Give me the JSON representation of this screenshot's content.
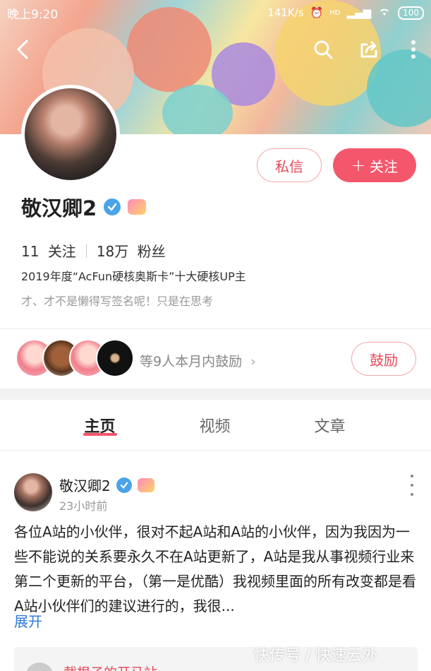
{
  "status_bar": {
    "time": "晚上9:20",
    "speed": "141K/s",
    "battery": "100",
    "network": "HD"
  },
  "profile": {
    "name": "敬汉卿2",
    "follow_count": "11",
    "follow_label": "关注",
    "fans_count": "18万",
    "fans_label": "粉丝",
    "award": "2019年度“AcFun硬核奥斯卡”十大硬核UP主",
    "signature": "才、才不是懒得写签名呢！只是在思考"
  },
  "actions": {
    "message": "私信",
    "follow": "关注",
    "follow_plus": "+",
    "cheer": "鼓励"
  },
  "cheer_row": {
    "text": "等9人本月内鼓励",
    "chevron": "›"
  },
  "tabs": [
    {
      "label": "主页"
    },
    {
      "label": "视频"
    },
    {
      "label": "文章"
    }
  ],
  "post": {
    "author": "敬汉卿2",
    "time": "23小时前",
    "text": "各位A站的小伙伴，很对不起A站和A站的小伙伴，因为我因为一些不能说的关系要永久不在A站更新了，A站是我从事视频行业来第二个更新的平台，（第一是优酷）我视频里面的所有改变都是看A站小伙伴们的建议进行的，我很...",
    "expand": "展开"
  },
  "shared": {
    "name": "截根子的开马站"
  },
  "watermark": "快传号 / 快速云外",
  "icons": {
    "back": "back-icon",
    "search": "search-icon",
    "share": "share-icon",
    "more": "more-icon",
    "verified": "verified-icon",
    "up_badge": "up-badge-icon"
  },
  "colors": {
    "accent": "#f4576b",
    "accent_text": "#e4495a",
    "link": "#2f7ad8",
    "verified": "#4aa3e8"
  }
}
